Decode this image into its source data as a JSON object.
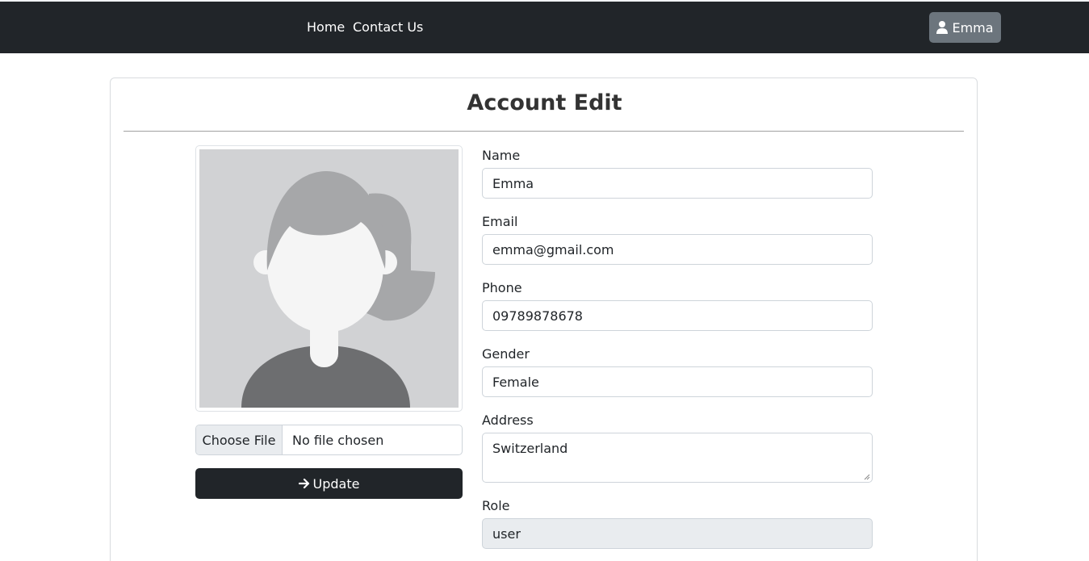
{
  "nav": {
    "links": [
      "Home",
      "Contact Us"
    ],
    "user_label": "Emma"
  },
  "page": {
    "title": "Account Edit"
  },
  "avatar": {
    "icon": "female-avatar-placeholder"
  },
  "upload": {
    "button_label": "Choose File",
    "status": "No file chosen"
  },
  "update": {
    "label": "Update",
    "icon": "arrow-right-icon"
  },
  "form": {
    "name_label": "Name",
    "name_value": "Emma",
    "email_label": "Email",
    "email_value": "emma@gmail.com",
    "phone_label": "Phone",
    "phone_value": "09789878678",
    "gender_label": "Gender",
    "gender_value": "Female",
    "address_label": "Address",
    "address_value": "Switzerland",
    "role_label": "Role",
    "role_value": "user"
  },
  "colors": {
    "navbar": "#212529",
    "user_button": "#6c757d",
    "update_button": "#212529",
    "readonly_field": "#e9ecef"
  }
}
